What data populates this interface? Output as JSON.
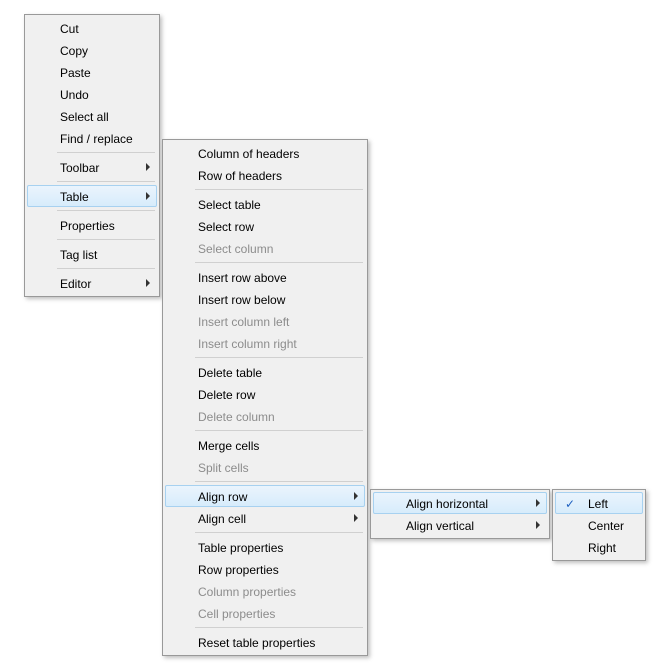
{
  "menu1": {
    "cut": "Cut",
    "copy": "Copy",
    "paste": "Paste",
    "undo": "Undo",
    "select_all": "Select all",
    "find_replace": "Find / replace",
    "toolbar": "Toolbar",
    "table": "Table",
    "properties": "Properties",
    "tag_list": "Tag list",
    "editor": "Editor"
  },
  "menu2": {
    "col_headers": "Column of headers",
    "row_headers": "Row of headers",
    "select_table": "Select table",
    "select_row": "Select row",
    "select_column": "Select column",
    "insert_row_above": "Insert row above",
    "insert_row_below": "Insert row below",
    "insert_col_left": "Insert column left",
    "insert_col_right": "Insert column right",
    "delete_table": "Delete table",
    "delete_row": "Delete row",
    "delete_column": "Delete column",
    "merge_cells": "Merge cells",
    "split_cells": "Split cells",
    "align_row": "Align row",
    "align_cell": "Align cell",
    "table_props": "Table properties",
    "row_props": "Row properties",
    "col_props": "Column properties",
    "cell_props": "Cell properties",
    "reset_props": "Reset table properties"
  },
  "menu3": {
    "align_h": "Align horizontal",
    "align_v": "Align vertical"
  },
  "menu4": {
    "left": "Left",
    "center": "Center",
    "right": "Right"
  }
}
